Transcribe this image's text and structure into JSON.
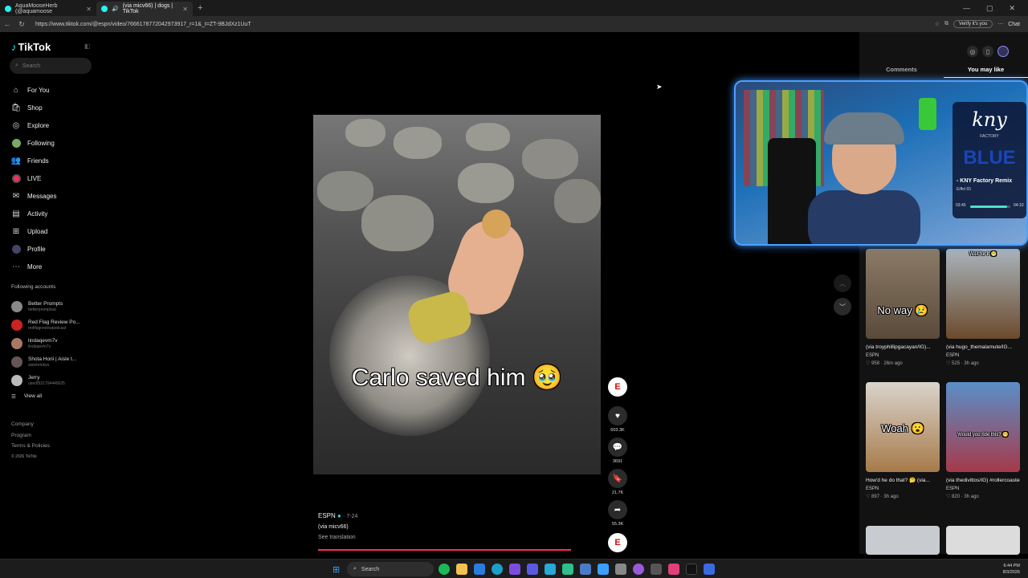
{
  "browser": {
    "tabs": [
      {
        "title": "AquaMooseHerb (@aquamoose"
      },
      {
        "title": "(via micv66) | dogs | TikTok"
      }
    ],
    "url": "https://www.tiktok.com/@espn/video/7666178772042973917_r=1&_t=ZT-9BJdXz1UuT",
    "verify_label": "Verify it's you",
    "chat_label": "Chat"
  },
  "sidebar": {
    "logo": "TikTok",
    "search_placeholder": "Search",
    "nav": [
      {
        "label": "For You",
        "icon": "home-icon"
      },
      {
        "label": "Shop",
        "icon": "shop-icon"
      },
      {
        "label": "Explore",
        "icon": "compass-icon"
      },
      {
        "label": "Following",
        "icon": "following-icon"
      },
      {
        "label": "Friends",
        "icon": "friends-icon"
      },
      {
        "label": "LIVE",
        "icon": "live-icon"
      },
      {
        "label": "Messages",
        "icon": "messages-icon"
      },
      {
        "label": "Activity",
        "icon": "activity-icon"
      },
      {
        "label": "Upload",
        "icon": "upload-icon"
      },
      {
        "label": "Profile",
        "icon": "profile-icon"
      },
      {
        "label": "More",
        "icon": "more-icon"
      }
    ],
    "following_title": "Following accounts",
    "following": [
      {
        "name": "Better Prompts",
        "handle": "betterpromptsai"
      },
      {
        "name": "Red Flag Review Po...",
        "handle": "redflagreviewpodcast"
      },
      {
        "name": "lindaqevm7v",
        "handle": "lindaqevm7v"
      },
      {
        "name": "Shota Horii | Aisle t...",
        "handle": "aisletotokyo"
      },
      {
        "name": "Jerry",
        "handle": "user8531704440025"
      }
    ],
    "view_all": "View all",
    "footer": [
      "Company",
      "Program",
      "Terms & Policies"
    ],
    "copyright": "© 2026 TikTok"
  },
  "video": {
    "caption": "Carlo saved him 🥹",
    "author": "ESPN",
    "date": "· 7-24",
    "description": "(via micv66)",
    "see_translation": "See translation",
    "likes": "603.3K",
    "comments": "3691",
    "saves": "21.7K",
    "shares": "55.3K",
    "progress": 0.9
  },
  "right_panel": {
    "tabs": [
      "Comments",
      "You may like"
    ],
    "active_tab": "You may like",
    "suggestions": [
      {
        "overlay": "No way 😢",
        "title": "(via troyphillipgacayan/IG)...",
        "author": "ESPN",
        "likes": "958",
        "age": "· 26m ago"
      },
      {
        "overlay": "Wait for it 😁",
        "title": "(via hugo_themalamute/IG...",
        "author": "ESPN",
        "likes": "525",
        "age": "· 3h ago"
      },
      {
        "overlay": "Woah 😮",
        "title": "How'd he do that? 🤔 (via...",
        "author": "ESPN",
        "likes": "897",
        "age": "· 3h ago"
      },
      {
        "overlay": "Would you ride this? 😬",
        "title": "(via thedivittos/IG) #rollercoaster #thrill...",
        "author": "ESPN",
        "likes": "820",
        "age": "· 3h ago"
      }
    ]
  },
  "webcam": {
    "brand": "kny",
    "brand_sub": "FACTORY",
    "blue": "BLUE",
    "track_title": "- KNY Factory Remix",
    "artist": "Eiffel 65",
    "time_elapsed": "03:45",
    "time_total": "04:10",
    "progress": 0.92
  },
  "taskbar": {
    "search": "Search",
    "time": "6:44 PM",
    "date": "8/3/2026"
  }
}
